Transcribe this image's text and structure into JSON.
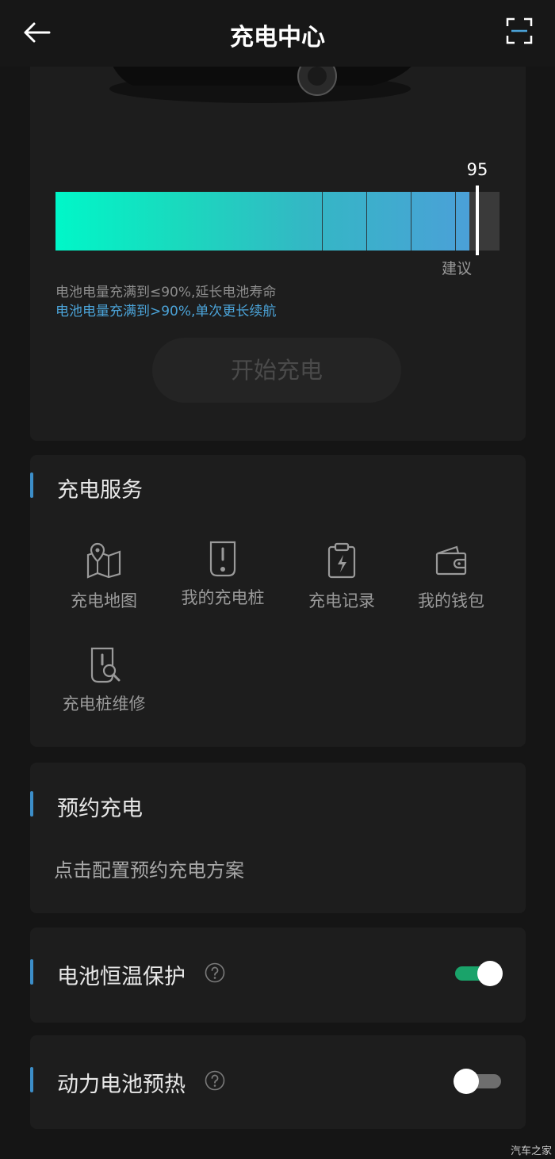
{
  "header": {
    "title": "充电中心",
    "back_icon": "arrow-left-icon",
    "scan_icon": "scan-frame-icon"
  },
  "battery": {
    "limit_value": "95",
    "limit_percent": 95,
    "suggest_label": "建议",
    "info_line1": "电池电量充满到≤90%,延长电池寿命",
    "info_line2": "电池电量充满到>90%,单次更长续航",
    "bar_colors": {
      "start": "#00f7c8",
      "end": "#4ba0d8",
      "rest": "#3a3a3a"
    }
  },
  "start_button": {
    "label": "开始充电"
  },
  "services": {
    "title": "充电服务",
    "items": [
      {
        "label": "充电地图",
        "icon": "map-pin-icon"
      },
      {
        "label": "我的充电桩",
        "icon": "charging-pile-icon"
      },
      {
        "label": "充电记录",
        "icon": "charge-record-icon"
      },
      {
        "label": "我的钱包",
        "icon": "wallet-icon"
      },
      {
        "label": "充电桩维修",
        "icon": "repair-icon"
      }
    ]
  },
  "reserve": {
    "title": "预约充电",
    "desc": "点击配置预约充电方案"
  },
  "thermal": {
    "label": "电池恒温保护",
    "enabled": true,
    "help_icon": "question-icon",
    "on_color": "#1aa36a"
  },
  "preheat": {
    "label": "动力电池预热",
    "enabled": false,
    "help_icon": "question-icon",
    "off_color": "#6e6e6e"
  },
  "watermark": "汽车之家"
}
